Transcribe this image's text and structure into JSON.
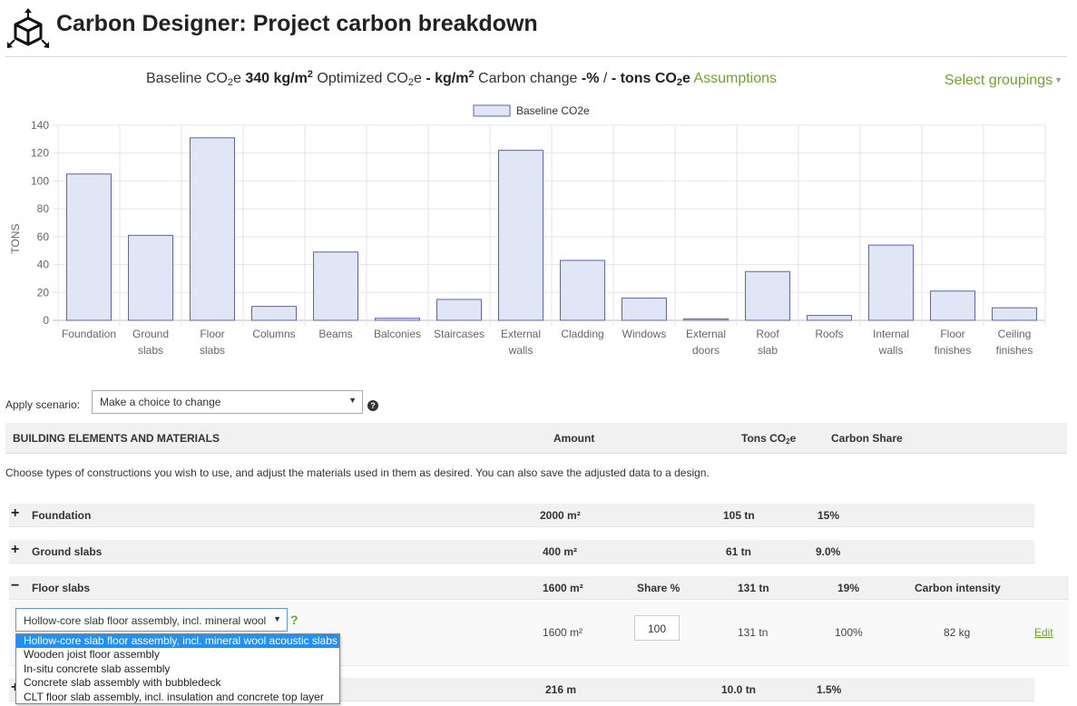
{
  "header": {
    "title": "Carbon Designer: Project carbon breakdown",
    "logo_icon": "cube-arrows-icon"
  },
  "summary": {
    "baseline_label_pre": "Baseline CO",
    "baseline_label_sub": "2",
    "baseline_label_post": "e",
    "baseline_value": "340 kg/m",
    "baseline_value_sup": "2",
    "optimized_label_pre": "Optimized CO",
    "optimized_label_sub": "2",
    "optimized_label_post": "e",
    "optimized_value": "- kg/m",
    "optimized_value_sup": "2",
    "carbon_change_label": "Carbon change",
    "carbon_change_value": "-%",
    "separator": "/",
    "tons_value_pre": "- tons CO",
    "tons_value_sub": "2",
    "tons_value_post": "e",
    "assumptions_link": "Assumptions",
    "select_groupings": "Select groupings"
  },
  "chart_data": {
    "type": "bar",
    "ylabel": "TONS",
    "ylim": [
      0,
      140
    ],
    "yticks": [
      "0",
      "20",
      "40",
      "60",
      "80",
      "100",
      "120",
      "140"
    ],
    "legend": "Baseline CO2e",
    "legend_position": "top",
    "grid": true,
    "bar_fill": "#e0e6f5",
    "bar_stroke": "#5b62b3",
    "categories": [
      [
        "Foundation"
      ],
      [
        "Ground",
        "slabs"
      ],
      [
        "Floor",
        "slabs"
      ],
      [
        "Columns"
      ],
      [
        "Beams"
      ],
      [
        "Balconies"
      ],
      [
        "Staircases"
      ],
      [
        "External",
        "walls"
      ],
      [
        "Cladding"
      ],
      [
        "Windows"
      ],
      [
        "External",
        "doors"
      ],
      [
        "Roof",
        "slab"
      ],
      [
        "Roofs"
      ],
      [
        "Internal",
        "walls"
      ],
      [
        "Floor",
        "finishes"
      ],
      [
        "Ceiling",
        "finishes"
      ]
    ],
    "series": [
      {
        "name": "Baseline CO2e",
        "values": [
          105,
          61,
          131,
          10,
          49,
          1.5,
          15,
          122,
          43,
          16,
          1,
          35,
          3.5,
          54,
          21,
          9
        ]
      }
    ]
  },
  "scenario": {
    "label": "Apply scenario:",
    "select_value": "Make a choice to change",
    "help": "?"
  },
  "table": {
    "headers": {
      "elements": "BUILDING ELEMENTS AND MATERIALS",
      "amount": "Amount",
      "tons_pre": "Tons CO",
      "tons_sub": "2",
      "tons_post": "e",
      "share": "Carbon Share"
    },
    "intro": "Choose types of constructions you wish to use, and adjust the materials used in them as desired. You can also save the adjusted data to a design.",
    "rows": [
      {
        "toggle": "+",
        "name": "Foundation",
        "amount": "2000 m²",
        "tons": "105 tn",
        "share": "15%"
      },
      {
        "toggle": "+",
        "name": "Ground slabs",
        "amount": "400 m²",
        "tons": "61 tn",
        "share": "9.0%"
      },
      {
        "toggle": "−",
        "name": "Floor slabs",
        "amount": "1600 m²",
        "share_col": "Share %",
        "tons": "131 tn",
        "share": "19%",
        "intensity_label": "Carbon intensity"
      }
    ],
    "next_row": {
      "toggle": "+",
      "amount": "216 m",
      "tons": "10.0 tn",
      "share": "1.5%"
    },
    "detail": {
      "construction": "Hollow-core slab floor assembly, incl. mineral wool",
      "help": "?",
      "amount": "1600 m²",
      "share_input": "100",
      "tons": "131 tn",
      "share": "100%",
      "intensity": "82 kg",
      "edit": "Edit"
    },
    "dropdown_options": [
      "Hollow-core slab floor assembly, incl. mineral wool acoustic slabs",
      "Wooden joist floor assembly",
      "In-situ concrete slab assembly",
      "Concrete slab assembly with bubbledeck",
      "CLT floor slab assembly, incl. insulation and concrete top layer"
    ]
  }
}
